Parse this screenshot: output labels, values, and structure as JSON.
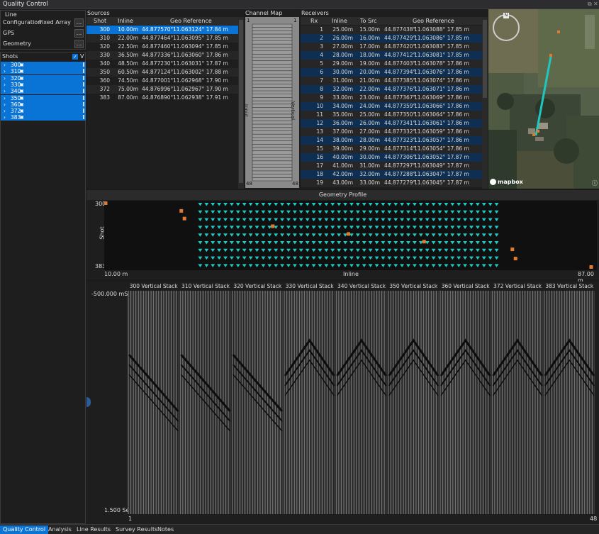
{
  "window": {
    "title": "Quality Control"
  },
  "line": {
    "title": "Line",
    "configuration_label": "Configuration",
    "configuration_value": "Fixed Array",
    "gps_label": "GPS",
    "geometry_label": "Geometry",
    "browse_label": "..."
  },
  "shots": {
    "title": "Shots",
    "checkbox_label": "V",
    "items": [
      "300",
      "310",
      "320",
      "330",
      "340",
      "350",
      "360",
      "372",
      "383"
    ]
  },
  "sources": {
    "title": "Sources",
    "headers": [
      "Shot",
      "Inline",
      "Geo Reference"
    ],
    "rows": [
      [
        "300",
        "10.00m",
        "44.877570°",
        "11.063124° 17.84 m"
      ],
      [
        "310",
        "22.00m",
        "44.877464°",
        "11.063095° 17.85 m"
      ],
      [
        "320",
        "22.50m",
        "44.877460°",
        "11.063094° 17.85 m"
      ],
      [
        "330",
        "36.50m",
        "44.877336°",
        "11.063060° 17.86 m"
      ],
      [
        "340",
        "48.50m",
        "44.877230°",
        "11.063031° 17.87 m"
      ],
      [
        "350",
        "60.50m",
        "44.877124°",
        "11.063002° 17.88 m"
      ],
      [
        "360",
        "74.50m",
        "44.877001°",
        "11.062968° 17.90 m"
      ],
      [
        "372",
        "75.00m",
        "44.876996°",
        "11.062967° 17.90 m"
      ],
      [
        "383",
        "87.00m",
        "44.876890°",
        "11.062938° 17.91 m"
      ]
    ]
  },
  "channel_map": {
    "title": "Channel Map",
    "top_left": "1",
    "top_right": "1",
    "bottom_left": "48",
    "bottom_right": "48",
    "left_label": "Input",
    "right_label": "Vertical"
  },
  "receivers": {
    "title": "Receivers",
    "headers": [
      "Rx",
      "Inline",
      "To Src",
      "Geo Reference"
    ],
    "rows": [
      [
        "1",
        "25.00m",
        "15.00m",
        "44.877438°",
        "11.063088° 17.85 m"
      ],
      [
        "2",
        "26.00m",
        "16.00m",
        "44.877429°",
        "11.063086° 17.85 m"
      ],
      [
        "3",
        "27.00m",
        "17.00m",
        "44.877420°",
        "11.063083° 17.85 m"
      ],
      [
        "4",
        "28.00m",
        "18.00m",
        "44.877412°",
        "11.063081° 17.85 m"
      ],
      [
        "5",
        "29.00m",
        "19.00m",
        "44.877403°",
        "11.063078° 17.86 m"
      ],
      [
        "6",
        "30.00m",
        "20.00m",
        "44.877394°",
        "11.063076° 17.86 m"
      ],
      [
        "7",
        "31.00m",
        "21.00m",
        "44.877385°",
        "11.063074° 17.86 m"
      ],
      [
        "8",
        "32.00m",
        "22.00m",
        "44.877376°",
        "11.063071° 17.86 m"
      ],
      [
        "9",
        "33.00m",
        "23.00m",
        "44.877367°",
        "11.063069° 17.86 m"
      ],
      [
        "10",
        "34.00m",
        "24.00m",
        "44.877359°",
        "11.063066° 17.86 m"
      ],
      [
        "11",
        "35.00m",
        "25.00m",
        "44.877350°",
        "11.063064° 17.86 m"
      ],
      [
        "12",
        "36.00m",
        "26.00m",
        "44.877341°",
        "11.063061° 17.86 m"
      ],
      [
        "13",
        "37.00m",
        "27.00m",
        "44.877332°",
        "11.063059° 17.86 m"
      ],
      [
        "14",
        "38.00m",
        "28.00m",
        "44.877323°",
        "11.063057° 17.86 m"
      ],
      [
        "15",
        "39.00m",
        "29.00m",
        "44.877314°",
        "11.063054° 17.86 m"
      ],
      [
        "16",
        "40.00m",
        "30.00m",
        "44.877306°",
        "11.063052° 17.87 m"
      ],
      [
        "17",
        "41.00m",
        "31.00m",
        "44.877297°",
        "11.063049° 17.87 m"
      ],
      [
        "18",
        "42.00m",
        "32.00m",
        "44.877288°",
        "11.063047° 17.87 m"
      ],
      [
        "19",
        "43.00m",
        "33.00m",
        "44.877279°",
        "11.063045° 17.87 m"
      ]
    ]
  },
  "map": {
    "brand": "mapbox",
    "compass": "N"
  },
  "chart_data": [
    {
      "type": "scatter",
      "title": "Geometry Profile",
      "xlabel": "Inline",
      "ylabel": "Shot",
      "xlim": [
        10,
        87
      ],
      "ylim": [
        300,
        383
      ],
      "x_start_label": "10.00 m",
      "x_end_label": "87.00 m",
      "y_top_label": "300",
      "y_bottom_label": "383",
      "series": [
        {
          "x": [
            10,
            22,
            22.5,
            36.5,
            48.5,
            60.5,
            74.5,
            75,
            87
          ],
          "y": [
            300,
            310,
            320,
            330,
            340,
            350,
            360,
            372,
            383
          ],
          "color": "#e07a30"
        }
      ]
    },
    {
      "type": "line",
      "panels": [
        "300 Vertical Stack",
        "310 Vertical Stack",
        "320 Vertical Stack",
        "330 Vertical Stack",
        "340 Vertical Stack",
        "350 Vertical Stack",
        "360 Vertical Stack",
        "372 Vertical Stack",
        "383 Vertical Stack"
      ],
      "y_top_label": "-500.000 mSec",
      "y_bottom_label": "1.500 Sec",
      "x_start_label": "1",
      "x_end_label": "48"
    }
  ],
  "tabs": [
    "Quality Control",
    "Analysis",
    "Line Results",
    "Survey Results",
    "Notes"
  ],
  "colors": {
    "accent": "#0a74d6",
    "receiver": "#1ec8c0",
    "source": "#e07a30"
  }
}
